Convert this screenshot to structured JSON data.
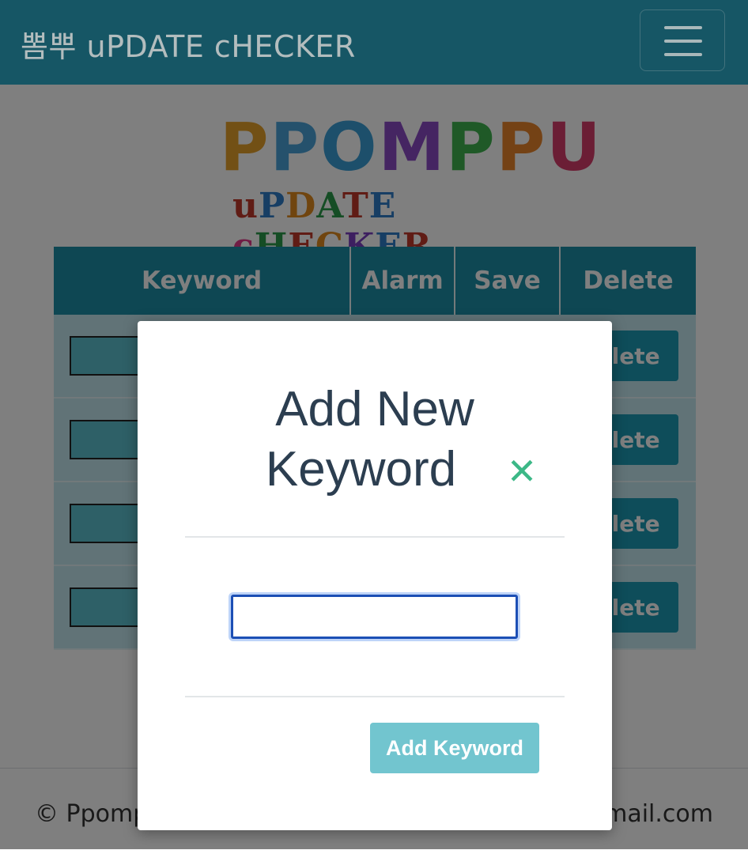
{
  "navbar": {
    "brand": "뽐뿌 uPDATE cHECKER",
    "menu_icon": "hamburger-menu-icon"
  },
  "logo": {
    "top_text": "PPOMPPU",
    "bottom_text": "uPDATE cHECKER",
    "top_colors": [
      "#e5a02a",
      "#4aa3d8",
      "#3b9fd6",
      "#8a4bc4",
      "#3fb34f",
      "#e8842b",
      "#d63d6a"
    ],
    "bottom_colors": [
      "#c0392b",
      "#2e7dc9",
      "#e08a1e",
      "#2b9b4a",
      "#c0392b",
      "#2e7dc9",
      "#9a3fc0",
      "#e03a8a",
      "#2b9b4a",
      "#c0392b",
      "#e08a1e",
      "#7a3fc0",
      "#2e7dc9",
      "#c0392b"
    ]
  },
  "table": {
    "headers": [
      "Keyword",
      "Alarm",
      "Save",
      "Delete"
    ],
    "rows": [
      {
        "keyword": "",
        "delete_label": "Delete"
      },
      {
        "keyword": "",
        "delete_label": "Delete"
      },
      {
        "keyword": "",
        "delete_label": "Delete"
      },
      {
        "keyword": "",
        "delete_label": "Delete"
      }
    ]
  },
  "footer": {
    "left": "© Ppomppu",
    "right": "@gmail.com"
  },
  "modal": {
    "title_line1": "Add New",
    "title_line2": "Keyword",
    "close_icon": "close-x-icon",
    "close_glyph": "✕",
    "input_value": "",
    "add_button": "Add Keyword"
  },
  "colors": {
    "navbar": "#1d6f82",
    "table_header": "#1c8ea7",
    "delete_button": "#1d9ab5",
    "close_icon": "#3cb887",
    "add_button": "#72c5cf",
    "title_text": "#2c3e50"
  }
}
